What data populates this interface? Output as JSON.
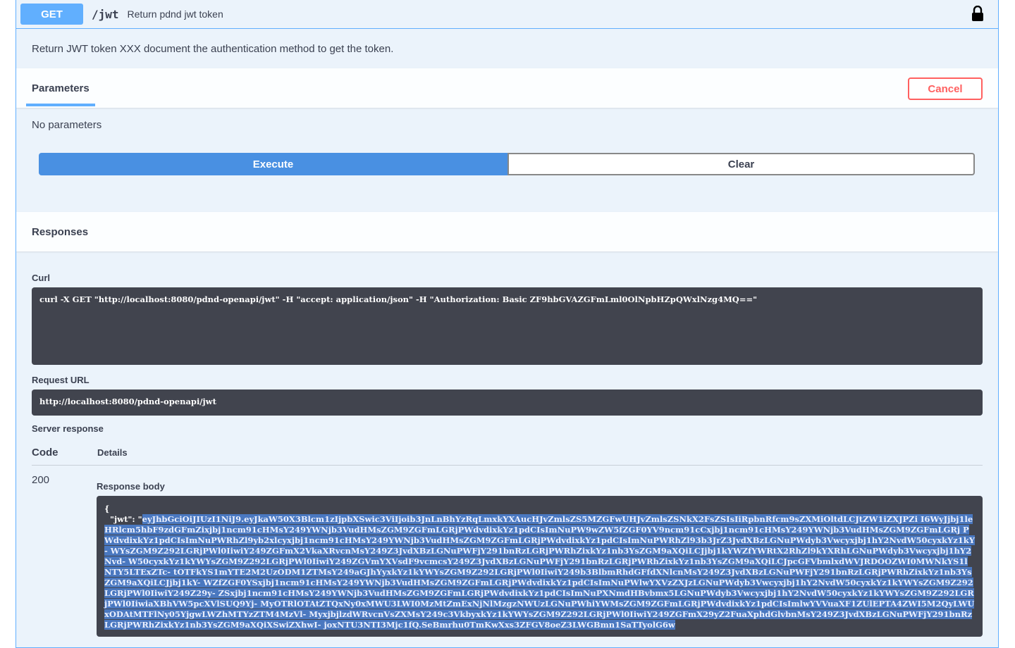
{
  "summary": {
    "method": "GET",
    "path": "/jwt",
    "description": "Return pdnd jwt token",
    "lock_icon": "lock-icon"
  },
  "description": "Return JWT token XXX document the authentication method to get the token.",
  "parameters": {
    "tab_label": "Parameters",
    "cancel_label": "Cancel",
    "empty_text": "No parameters"
  },
  "actions": {
    "execute_label": "Execute",
    "clear_label": "Clear"
  },
  "responses": {
    "title": "Responses",
    "curl_label": "Curl",
    "curl_command": "curl -X GET \"http://localhost:8080/pdnd-openapi/jwt\" -H \"accept: application/json\" -H \"Authorization: Basic ZF9hbGVAZGFmLml0OlNpbHZpQWxlNzg4MQ==\"",
    "request_url_label": "Request URL",
    "request_url": "http://localhost:8080/pdnd-openapi/jwt",
    "server_response_label": "Server response",
    "table_headers": {
      "code": "Code",
      "details": "Details"
    },
    "status_code": "200",
    "response_body_label": "Response body",
    "body_open": "{",
    "body_key": "\"jwt\": \"",
    "body_token": "eyJhbGciOiJIUzI1NiJ9.eyJkaW50X3Blcm1zIjpbXSwic3ViIjoib3JnLnBhYzRqLmxkYXAucHJvZmlsZS5MZGFwUHJvZmlsZSNkX2FsZSIsIiRpbnRfcm9sZXMiOltdLCJtZW1iZXJPZi I6WyJjbj1leHRlcm5hbF9zdGFmZixjbj1ncm91cHMsY249YWNjb3VudHMsZGM9ZGFmLGRjPWdvdixkYz1pdCIsImNuPW9wZW5fZGF0YV9ncm91cCxjbj1ncm91cHMsY249YWNjb3VudHMsZGM9ZGFmLGRj PWdvdixkYz1pdCIsImNuPWRhZl9yb2xlcyxjbj1ncm91cHMsY249YWNjb3VudHMsZGM9ZGFmLGRjPWdvdixkYz1pdCIsImNuPWRhZl93b3JrZ3JvdXBzLGNuPWdyb3Vwcyxjbj1hY2NvdW50cyxkYz1kY- WYsZGM9Z292LGRjPWl0IiwiY249ZGFmX2VkaXRvcnMsY249Z3JvdXBzLGNuPWFjY291bnRzLGRjPWRhZixkYz1nb3YsZGM9aXQiLCJjbj1kYWZfYWRtX2RhZl9kYXRhLGNuPWdyb3Vwcyxjbj1hY2Nvd- W50cyxkYz1kYWYsZGM9Z292LGRjPWl0IiwiY249ZGVmYXVsdF9vcmcsY249Z3JvdXBzLGNuPWFjY291bnRzLGRjPWRhZixkYz1nb3YsZGM9aXQiLCJpcGFVbmlxdWVJRDOOZWI0MWNkYS1lNTY5LTExZTc- tOTFkYS1mYTE2M2UzODM1ZTMsY249aGJhYyxkYz1kYWYsZGM9Z292LGRjPWl0IiwiY249b3BlbmRhdGFfdXNlcnMsY249Z3JvdXBzLGNuPWFjY291bnRzLGRjPWRhZixkYz1nb3YsZGM9aXQiLCJjbj1kY- WZfZGF0YSxjbj1ncm91cHMsY249YWNjb3VudHMsZGM9ZGFmLGRjPWdvdixkYz1pdCIsImNuPWlwYXVzZXJzLGNuPWdyb3Vwcyxjbj1hY2NvdW50cyxkYz1kYWYsZGM9Z292LGRjPWl0IiwiY249Z29y- ZSxjbj1ncm91cHMsY249YWNjb3VudHMsZGM9ZGFmLGRjPWdvdixkYz1pdCIsImNuPXNmdHBvbmx5LGNuPWdyb3Vwcyxjbj1hY2NvdW50cyxkYz1kYWYsZGM9Z292LGRjPWl0IiwiaXBhVW5pcXVlSUQ9Yj- MyOTRlOTAtZTQxNy0xMWU3LWI0MzMtZmExNjNlMzgzNWUzLGNuPWhiYWMsZGM9ZGFmLGRjPWdvdixkYz1pdCIsImlwYVVuaXF1ZUlEPTA4ZWI5M2QyLWUxODAtMTFlNy05YjgwLWZhMTYzZTM4MzVl- MyxjbjlzdWRvcnVsZXMsY249c3VkbyxkYz1kYWYsZGM9Z292LGRjPWl0IiwiY249ZGFmX29yZ2FuaXphdGlvbnMsY249Z3JvdXBzLGNuPWFjY291bnRzLGRjPWRhZixkYz1nb3YsZGM9aXQiXSwiZXhwI- joxNTU3NTI3Mjc1fQ.SeBmrhu0TmKwXxs3ZFGV8oeZ3LWGBmn1SaTTyolG6w"
  }
}
